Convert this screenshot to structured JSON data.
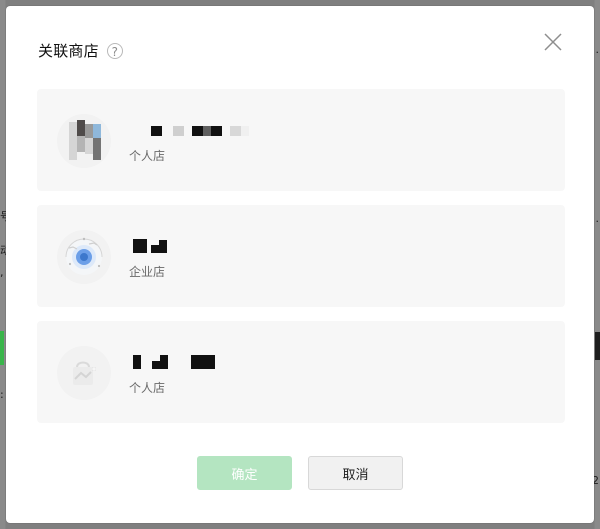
{
  "dialog": {
    "title": "关联商店",
    "help_icon": "question-circle-icon",
    "close_icon": "close-icon"
  },
  "stores": [
    {
      "type_label": "个人店",
      "avatar_icon": "store-avatar-icon"
    },
    {
      "type_label": "企业店",
      "avatar_icon": "globe-avatar-icon"
    },
    {
      "type_label": "个人店",
      "avatar_icon": "bag-avatar-icon"
    }
  ],
  "footer": {
    "confirm_label": "确定",
    "cancel_label": "取消"
  },
  "colors": {
    "modal_bg": "#ffffff",
    "card_bg": "#f7f7f7",
    "confirm_bg": "#b4e5c1",
    "cancel_bg": "#f1f1f1",
    "backdrop": "#7f7f7f"
  }
}
